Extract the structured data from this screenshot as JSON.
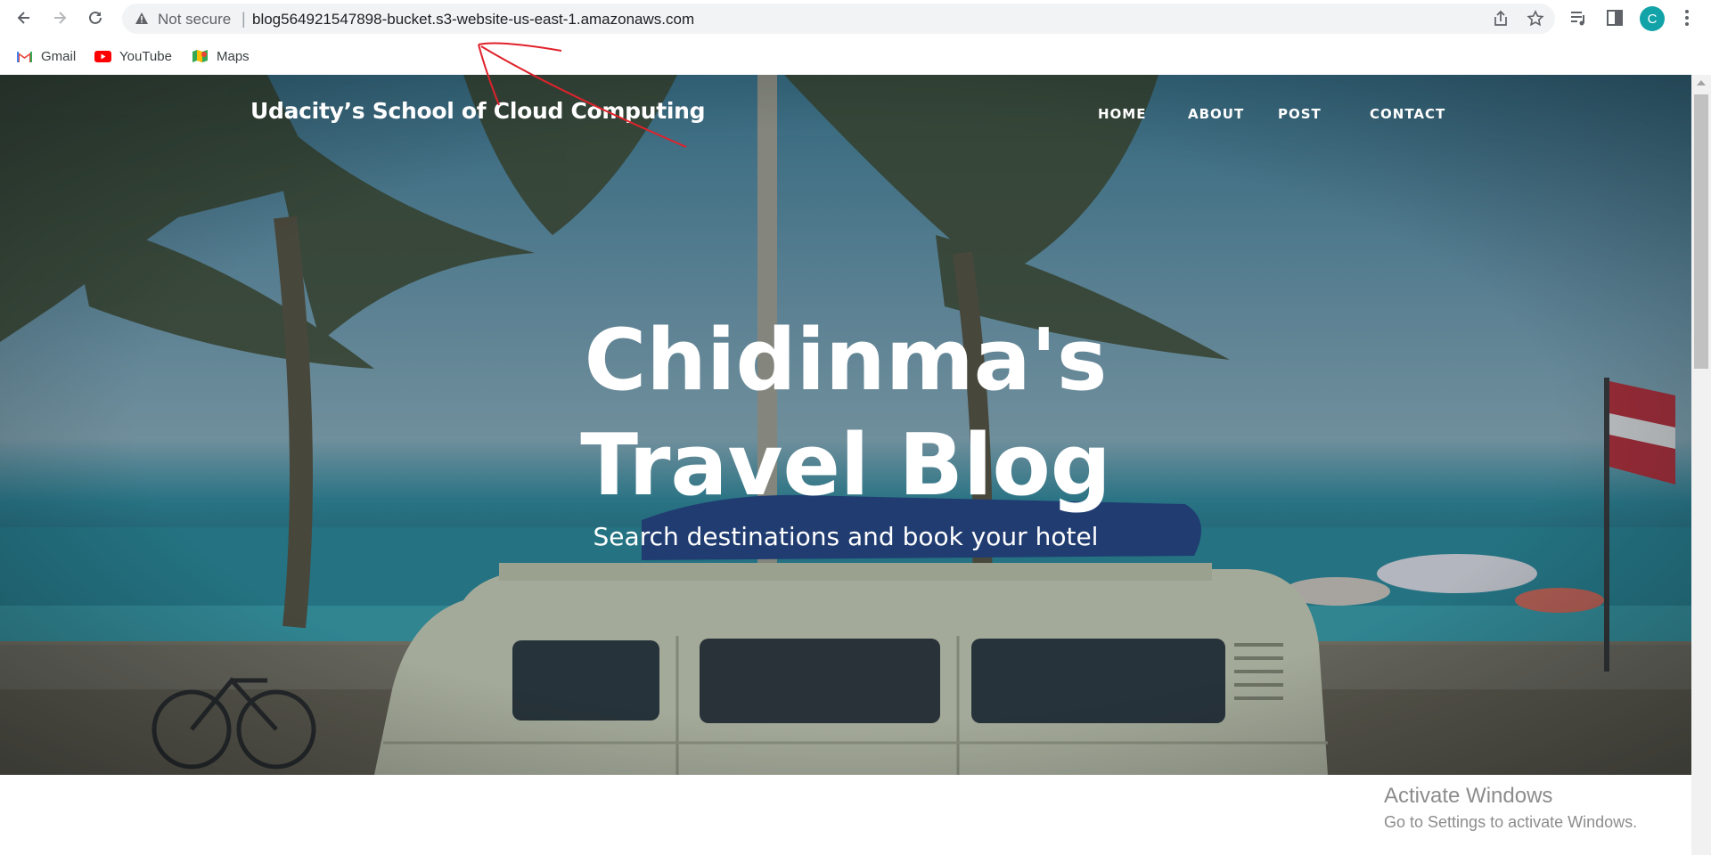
{
  "browser": {
    "security_text": "Not secure",
    "separator": "|",
    "url": "blog564921547898-bucket.s3-website-us-east-1.amazonaws.com",
    "profile_initial": "C"
  },
  "bookmarks": [
    {
      "label": "Gmail",
      "icon": "gmail-icon"
    },
    {
      "label": "YouTube",
      "icon": "youtube-icon"
    },
    {
      "label": "Maps",
      "icon": "maps-icon"
    }
  ],
  "site": {
    "brand": "Udacity’s School of Cloud Computing",
    "nav": [
      "HOME",
      "ABOUT",
      "POST",
      "CONTACT"
    ],
    "title_line1": "Chidinma's",
    "title_line2": "Travel Blog",
    "subtitle": "Search destinations and book your hotel"
  },
  "os_watermark": {
    "line1": "Activate Windows",
    "line2": "Go to Settings to activate Windows."
  },
  "colors": {
    "avatar": "#11a3a8",
    "annotation": "#e0222b"
  }
}
